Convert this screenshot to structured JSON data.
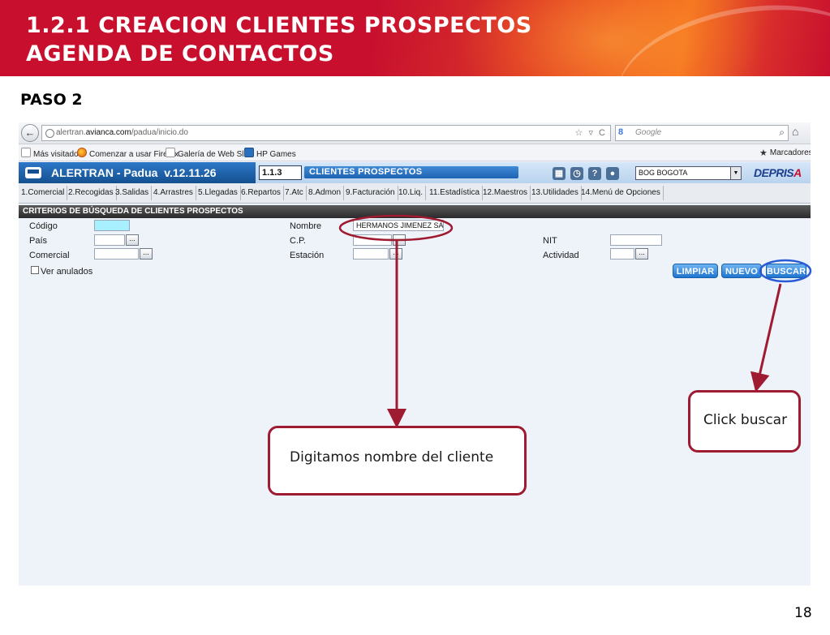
{
  "slide": {
    "title_line1": "1.2.1 CREACION CLIENTES PROSPECTOS",
    "title_line2": "AGENDA DE CONTACTOS",
    "step": "PASO 2",
    "page_number": "18"
  },
  "browser": {
    "url_prefix": "alertran.",
    "url_domain": "avianca.com",
    "url_path": "/padua/inicio.do",
    "url_icons": "☆ ▿ C",
    "search_placeholder": "Google",
    "search_logo": "8",
    "bookmarks": [
      "Más visitados",
      "Comenzar a usar Firefox",
      "Galería de Web Slice",
      "HP Games"
    ],
    "bookmarks_menu": "Marcadores"
  },
  "app": {
    "name": "ALERTRAN - Padua  v.12.11.26",
    "code": "1.1.3",
    "module": "CLIENTES PROSPECTOS",
    "city": "BOG BOGOTA",
    "brand_a": "DEPRIS",
    "brand_b": "A",
    "menu": [
      "1.Comercial",
      "2.Recogidas",
      "3.Salidas",
      "4.Arrastres",
      "5.Llegadas",
      "6.Repartos",
      "7.Atc",
      "8.Admon",
      "9.Facturación",
      "10.Liq.",
      "11.Estadística",
      "12.Maestros",
      "13.Utilidades",
      "14.Menú de Opciones"
    ]
  },
  "form": {
    "section_title": "CRITERIOS DE BÚSQUEDA DE CLIENTES PROSPECTOS",
    "labels": {
      "codigo": "Código",
      "pais": "País",
      "comercial": "Comercial",
      "ver_anulados": "Ver anulados",
      "nombre": "Nombre",
      "cp": "C.P.",
      "estacion": "Estación",
      "nit": "NIT",
      "actividad": "Actividad"
    },
    "values": {
      "nombre": "HERMANOS JIMENEZ SA"
    },
    "lookup_label": "...",
    "buttons": {
      "limpiar": "LIMPIAR",
      "nuevo": "NUEVO",
      "buscar": "BUSCAR"
    }
  },
  "annotations": {
    "callout_name": "Digitamos nombre del cliente",
    "callout_search": "Click buscar"
  },
  "colors": {
    "annotation": "#9e1b32",
    "banner_red": "#c8102e",
    "app_blue": "#1f75cf"
  }
}
